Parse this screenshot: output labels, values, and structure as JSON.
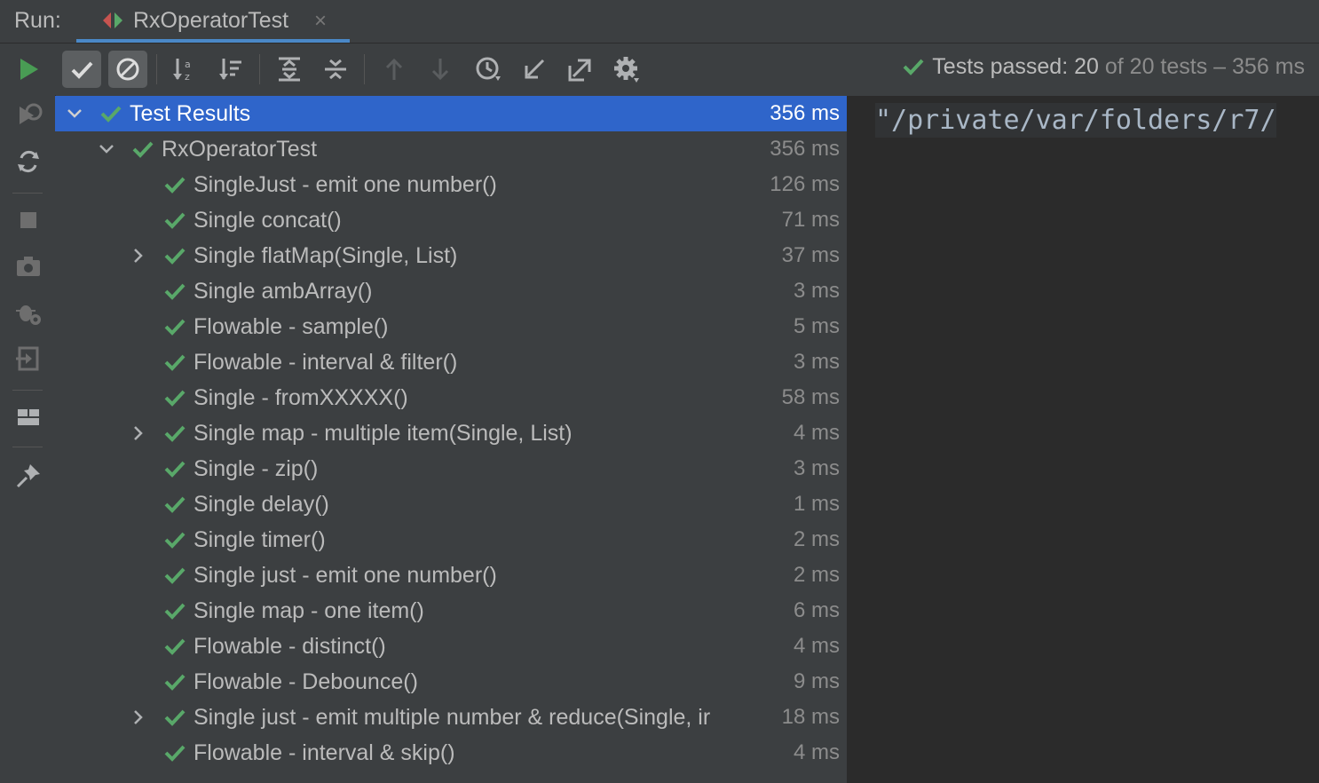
{
  "run_panel": {
    "label": "Run:",
    "tab_title": "RxOperatorTest",
    "close_glyph": "×"
  },
  "sidebar": {
    "buttons": [
      "rerun-icon",
      "rerun-failed-icon",
      "toggle-auto-test-icon",
      "stop-icon",
      "screenshot-icon",
      "debug-settings-icon",
      "exit-icon",
      "layout-icon",
      "pin-icon"
    ]
  },
  "toolbar": {
    "buttons": [
      "show-passed-icon",
      "show-ignored-icon",
      "sort-alphabetically-icon",
      "sort-by-duration-icon",
      "expand-all-icon",
      "collapse-all-icon",
      "previous-failed-icon",
      "next-failed-icon",
      "test-history-icon",
      "import-tests-icon",
      "export-tests-icon",
      "settings-icon"
    ],
    "status_prefix": "Tests passed:",
    "status_passed": "20",
    "status_suffix": "of 20 tests – 356 ms"
  },
  "tree": {
    "root": {
      "name": "Test Results",
      "time": "356 ms"
    },
    "suite": {
      "name": "RxOperatorTest",
      "time": "356 ms"
    },
    "tests": [
      {
        "name": "SingleJust - emit one number()",
        "time": "126 ms",
        "expandable": false
      },
      {
        "name": "Single concat()",
        "time": "71 ms",
        "expandable": false
      },
      {
        "name": "Single flatMap(Single, List)",
        "time": "37 ms",
        "expandable": true
      },
      {
        "name": "Single ambArray()",
        "time": "3 ms",
        "expandable": false
      },
      {
        "name": "Flowable - sample()",
        "time": "5 ms",
        "expandable": false
      },
      {
        "name": "Flowable - interval & filter()",
        "time": "3 ms",
        "expandable": false
      },
      {
        "name": "Single - fromXXXXX()",
        "time": "58 ms",
        "expandable": false
      },
      {
        "name": "Single map - multiple item(Single, List)",
        "time": "4 ms",
        "expandable": true
      },
      {
        "name": "Single - zip()",
        "time": "3 ms",
        "expandable": false
      },
      {
        "name": "Single delay()",
        "time": "1 ms",
        "expandable": false
      },
      {
        "name": "Single timer()",
        "time": "2 ms",
        "expandable": false
      },
      {
        "name": "Single just - emit one number()",
        "time": "2 ms",
        "expandable": false
      },
      {
        "name": "Single map - one item()",
        "time": "6 ms",
        "expandable": false
      },
      {
        "name": "Flowable - distinct()",
        "time": "4 ms",
        "expandable": false
      },
      {
        "name": "Flowable - Debounce()",
        "time": "9 ms",
        "expandable": false
      },
      {
        "name": "Single just - emit multiple number & reduce(Single, ir",
        "time": "18 ms",
        "expandable": true
      },
      {
        "name": "Flowable - interval & skip()",
        "time": "4 ms",
        "expandable": false
      }
    ]
  },
  "console": {
    "line": "\"/private/var/folders/r7/"
  },
  "colors": {
    "background": "#3c3f41",
    "console_bg": "#2b2b2b",
    "selection": "#2f65ca",
    "pass_green": "#59a869",
    "run_green": "#499c54",
    "tab_underline": "#4a88c7"
  }
}
